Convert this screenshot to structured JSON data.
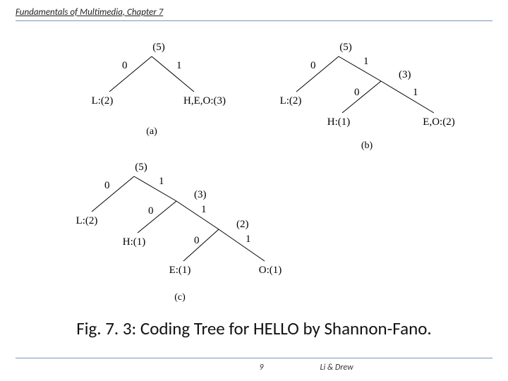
{
  "header": {
    "title": "Fundamentals of Multimedia, Chapter 7"
  },
  "caption": "Fig. 7. 3: Coding Tree for HELLO by Shannon-Fano.",
  "footer": {
    "page": "9",
    "authors": "Li & Drew"
  },
  "trees": {
    "a": {
      "sub": "(a)",
      "root": "(5)",
      "edge0": "0",
      "edge1": "1",
      "leaf0": "L:(2)",
      "leaf1": "H,E,O:(3)"
    },
    "b": {
      "sub": "(b)",
      "root": "(5)",
      "edge0": "0",
      "edge1": "1",
      "right": "(3)",
      "edge10": "0",
      "edge11": "1",
      "leaf0": "L:(2)",
      "leaf10": "H:(1)",
      "leaf11": "E,O:(2)"
    },
    "c": {
      "sub": "(c)",
      "root": "(5)",
      "edge0": "0",
      "edge1": "1",
      "n1": "(3)",
      "edge10": "0",
      "edge11": "1",
      "n11": "(2)",
      "edge110": "0",
      "edge111": "1",
      "leaf0": "L:(2)",
      "leaf10": "H:(1)",
      "leaf110": "E:(1)",
      "leaf111": "O:(1)"
    }
  }
}
